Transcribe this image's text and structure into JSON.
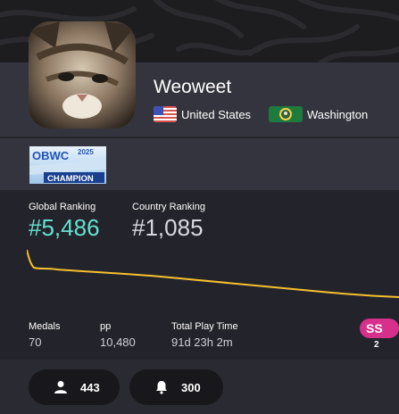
{
  "profile": {
    "username": "Weoweet",
    "country": "United States",
    "region": "Washington"
  },
  "badge": {
    "line1": "OBWC",
    "year": "2025",
    "line2": "CHAMPION"
  },
  "ranking": {
    "global_label": "Global Ranking",
    "global_value": "#5,486",
    "country_label": "Country Ranking",
    "country_value": "#1,085"
  },
  "stats": {
    "medals_label": "Medals",
    "medals_value": "70",
    "pp_label": "pp",
    "pp_value": "10,480",
    "playtime_label": "Total Play Time",
    "playtime_value": "91d 23h 2m"
  },
  "grade": {
    "label": "SS",
    "count": "2",
    "color": "#c2185b"
  },
  "social": {
    "followers": "443",
    "subscribers": "300"
  },
  "colors": {
    "global_rank": "#66e0cf",
    "graph_line": "#f6c12e",
    "grade_ss": "#d6308c"
  },
  "icons": {
    "followers": "user-icon",
    "subscribers": "bell-icon"
  }
}
